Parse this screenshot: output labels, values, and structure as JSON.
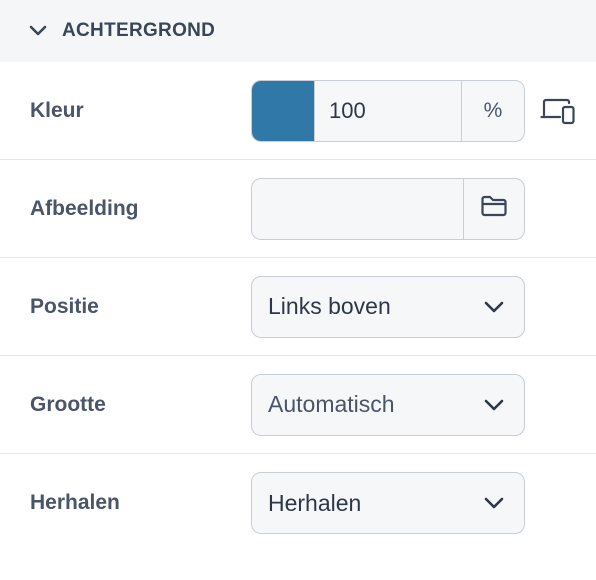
{
  "section": {
    "title": "ACHTERGROND",
    "chevron_icon": "chevron-down-icon"
  },
  "color": {
    "label": "Kleur",
    "swatch_color": "#2f78a8",
    "opacity_value": "100",
    "opacity_unit": "%",
    "device_icon": "responsive-devices-icon"
  },
  "image": {
    "label": "Afbeelding",
    "value": "",
    "browse_icon": "folder-icon"
  },
  "position": {
    "label": "Positie",
    "selected": "Links boven"
  },
  "size": {
    "label": "Grootte",
    "selected": "Automatisch"
  },
  "repeat": {
    "label": "Herhalen",
    "selected": "Herhalen"
  },
  "colors": {
    "header_bg": "#f5f6f8",
    "label_text": "#4a5568",
    "border": "#c8ced6",
    "control_bg": "#f6f7f9"
  }
}
